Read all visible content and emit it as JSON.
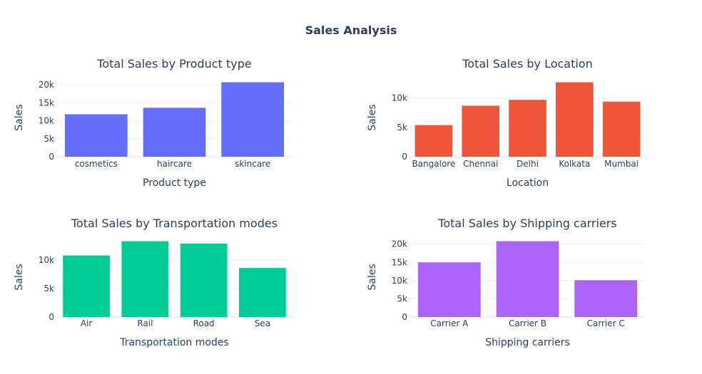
{
  "title": "Sales Analysis",
  "chart_data": [
    {
      "type": "bar",
      "title": "Total Sales by Product type",
      "xlabel": "Product type",
      "ylabel": "Sales",
      "categories": [
        "cosmetics",
        "haircare",
        "skincare"
      ],
      "values": [
        11800,
        13600,
        20700
      ],
      "ylim": [
        0,
        21790
      ],
      "yticks": [
        0,
        5000,
        10000,
        15000,
        20000
      ],
      "ytick_labels": [
        "0",
        "5k",
        "10k",
        "15k",
        "20k"
      ],
      "color": "#636efa",
      "grid": true
    },
    {
      "type": "bar",
      "title": "Total Sales by Location",
      "xlabel": "Location",
      "ylabel": "Sales",
      "categories": [
        "Bangalore",
        "Chennai",
        "Delhi",
        "Kolkata",
        "Mumbai"
      ],
      "values": [
        5400,
        8700,
        9700,
        12700,
        9400
      ],
      "ylim": [
        0,
        13370
      ],
      "yticks": [
        0,
        5000,
        10000
      ],
      "ytick_labels": [
        "0",
        "5k",
        "10k"
      ],
      "color": "#ef553b",
      "grid": true
    },
    {
      "type": "bar",
      "title": "Total Sales by Transportation modes",
      "xlabel": "Transportation modes",
      "ylabel": "Sales",
      "categories": [
        "Air",
        "Rail",
        "Road",
        "Sea"
      ],
      "values": [
        10800,
        13300,
        12900,
        8600
      ],
      "ylim": [
        0,
        14000
      ],
      "yticks": [
        0,
        5000,
        10000
      ],
      "ytick_labels": [
        "0",
        "5k",
        "10k"
      ],
      "color": "#00cc96",
      "grid": true
    },
    {
      "type": "bar",
      "title": "Total Sales by Shipping carriers",
      "xlabel": "Shipping carriers",
      "ylabel": "Sales",
      "categories": [
        "Carrier A",
        "Carrier B",
        "Carrier C"
      ],
      "values": [
        15000,
        20800,
        10100
      ],
      "ylim": [
        0,
        21890
      ],
      "yticks": [
        0,
        5000,
        10000,
        15000,
        20000
      ],
      "ytick_labels": [
        "0",
        "5k",
        "10k",
        "15k",
        "20k"
      ],
      "color": "#ab63fa",
      "grid": true
    }
  ]
}
